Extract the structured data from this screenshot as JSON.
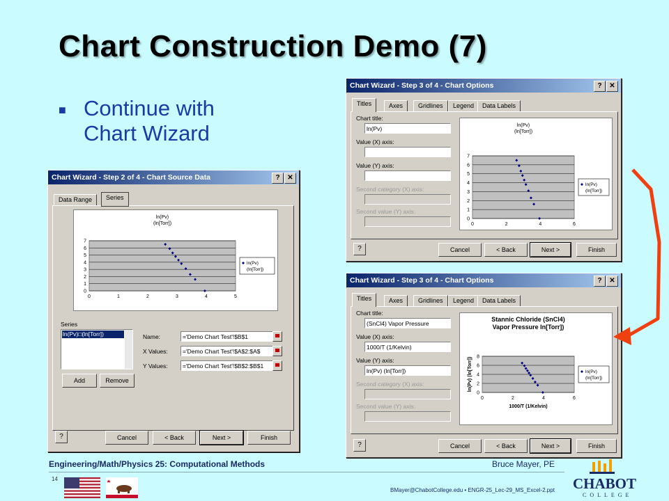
{
  "slide": {
    "title": "Chart Construction Demo (7)",
    "bullet_line1": "Continue with",
    "bullet_line2": "Chart Wizard"
  },
  "colors": {
    "arrow": "#f04010",
    "title_bar": "#0a246a",
    "background": "#c9fbff"
  },
  "win_source": {
    "title": "Chart Wizard - Step 2 of 4 - Chart Source Data",
    "tabs": [
      "Data Range",
      "Series"
    ],
    "series_label": "Series",
    "series_item": "ln(Pv)□(ln[Torr])",
    "name_label": "Name:",
    "name_value": "='Demo Chart Test'!$B$1",
    "xvals_label": "X Values:",
    "xvals_value": "='Demo Chart Test'!$A$2:$A$",
    "yvals_label": "Y Values:",
    "yvals_value": "='Demo Chart Test'!$B$2:$B$1",
    "add": "Add",
    "remove": "Remove",
    "cancel": "Cancel",
    "back": "< Back",
    "next": "Next >",
    "finish": "Finish"
  },
  "win_opts1": {
    "title": "Chart Wizard - Step 3 of 4 - Chart Options",
    "tabs": [
      "Titles",
      "Axes",
      "Gridlines",
      "Legend",
      "Data Labels"
    ],
    "chart_title_label": "Chart title:",
    "chart_title_value": "ln(Pv)",
    "x_label": "Value (X) axis:",
    "x_value": "",
    "y_label": "Value (Y) axis:",
    "y_value": "",
    "cat_label": "Second category (X) axis:",
    "val_label": "Second value (Y) axis:",
    "cancel": "Cancel",
    "back": "< Back",
    "next": "Next >",
    "finish": "Finish"
  },
  "win_opts2": {
    "title": "Chart Wizard - Step 3 of 4 - Chart Options",
    "tabs": [
      "Titles",
      "Axes",
      "Gridlines",
      "Legend",
      "Data Labels"
    ],
    "chart_title_label": "Chart title:",
    "chart_title_value": "(SnCl4) Vapor Pressure",
    "x_label": "Value (X) axis:",
    "x_value": "1000/T (1/Kelvin)",
    "y_label": "Value (Y) axis:",
    "y_value": "ln(Pv) (ln[Torr])",
    "cat_label": "Second category (X) axis:",
    "val_label": "Second value (Y) axis:",
    "cancel": "Cancel",
    "back": "< Back",
    "next": "Next >",
    "finish": "Finish"
  },
  "chart_data": [
    {
      "type": "scatter",
      "title": "ln(Pv) (ln[Torr])",
      "xlabel": "",
      "ylabel": "",
      "xlim": [
        0,
        5
      ],
      "ylim": [
        0,
        7
      ],
      "xticks": [
        "0",
        "1",
        "2",
        "3",
        "4",
        "5"
      ],
      "yticks": [
        "0",
        "1",
        "2",
        "3",
        "4",
        "5",
        "6",
        "7"
      ],
      "legend": "ln(Pv) (ln[Torr])",
      "legend_position": "right",
      "x": [
        2.6,
        2.75,
        2.85,
        2.95,
        3.05,
        3.15,
        3.3,
        3.45,
        3.62,
        3.95
      ],
      "y": [
        6.5,
        5.9,
        5.3,
        4.8,
        4.3,
        3.8,
        3.1,
        2.3,
        1.6,
        0.0
      ]
    },
    {
      "type": "scatter",
      "title": "ln(Pv) (ln[Torr])",
      "xlabel": "",
      "ylabel": "",
      "xlim": [
        0,
        6
      ],
      "ylim": [
        0,
        7
      ],
      "xticks": [
        "0",
        "2",
        "4",
        "6"
      ],
      "yticks": [
        "0",
        "1",
        "2",
        "3",
        "4",
        "5",
        "6",
        "7"
      ],
      "legend": "ln(Pv) (ln[Torr])",
      "legend_position": "right",
      "x": [
        2.6,
        2.75,
        2.85,
        2.95,
        3.05,
        3.15,
        3.3,
        3.45,
        3.62,
        3.95
      ],
      "y": [
        6.5,
        5.9,
        5.3,
        4.8,
        4.3,
        3.8,
        3.1,
        2.3,
        1.6,
        0.0
      ]
    },
    {
      "type": "scatter",
      "title": "Stannic Chloride (SnCl4) Vapor Pressure ln[Torr])",
      "xlabel": "1000/T (1/Kelvin)",
      "ylabel": "ln(Pv) (ln[Torr])",
      "xlim": [
        0,
        6
      ],
      "ylim": [
        0,
        8
      ],
      "xticks": [
        "0",
        "2",
        "4",
        "6"
      ],
      "yticks": [
        "0",
        "2",
        "4",
        "6",
        "8"
      ],
      "legend": "ln(Pv) (ln[Torr])",
      "legend_position": "right",
      "x": [
        2.6,
        2.75,
        2.85,
        2.95,
        3.05,
        3.15,
        3.3,
        3.45,
        3.62,
        3.95
      ],
      "y": [
        6.5,
        5.9,
        5.3,
        4.8,
        4.3,
        3.8,
        3.1,
        2.3,
        1.6,
        0.0
      ]
    }
  ],
  "footer": {
    "course": "Engineering/Math/Physics 25: Computational Methods",
    "author": "Bruce Mayer, PE",
    "page": "14",
    "email": "BMayer@ChabotCollege.edu  • ENGR-25_Lec-29_MS_Excel-2.ppt",
    "logo_text": "CHABOT",
    "logo_sub": "COLLEGE"
  }
}
